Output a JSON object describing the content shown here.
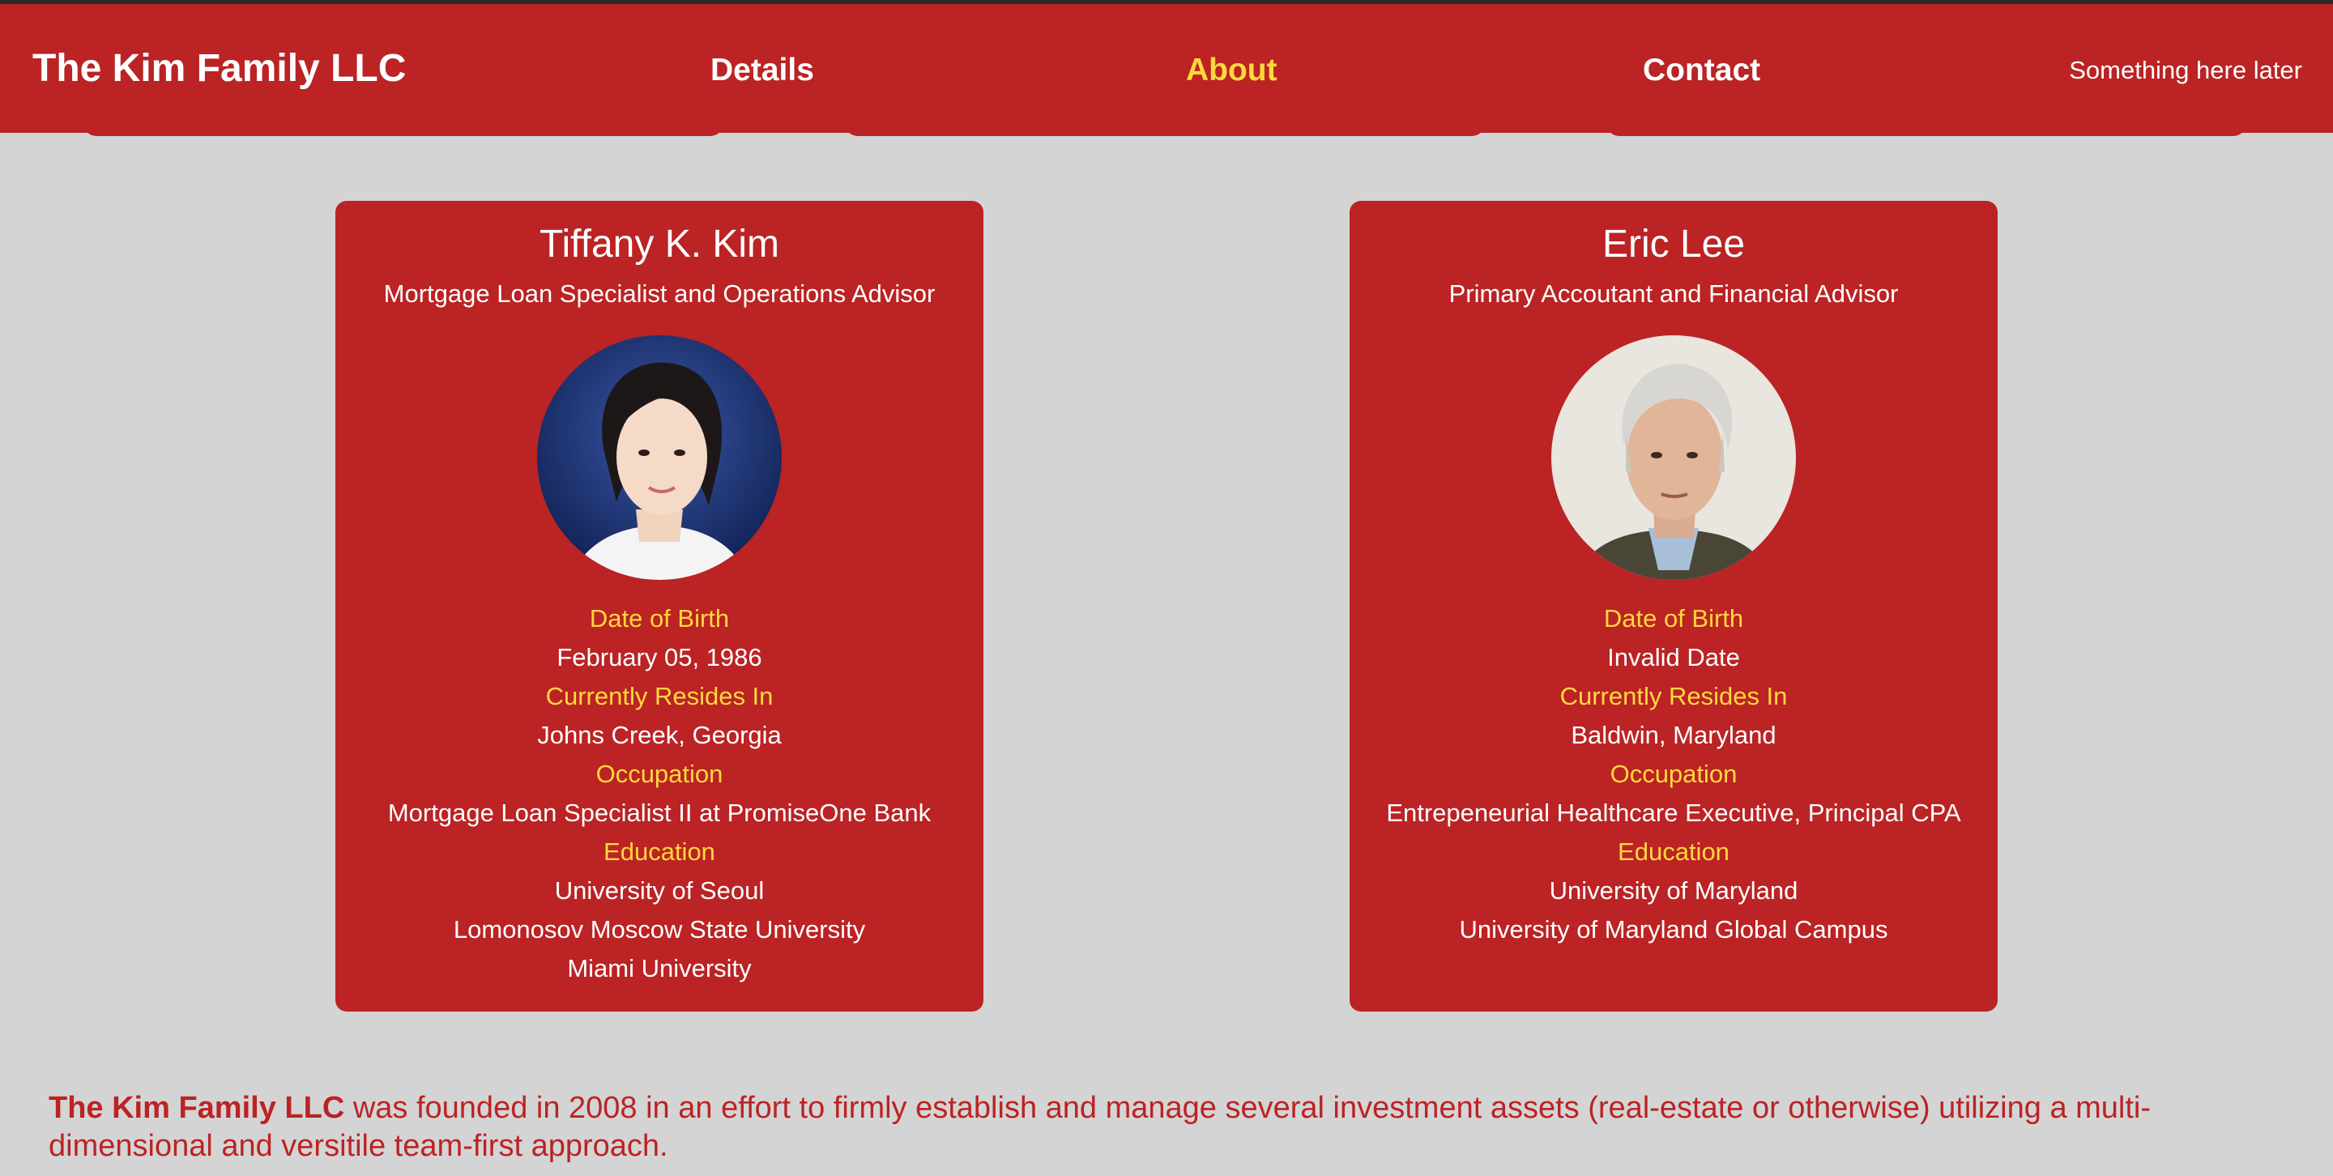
{
  "header": {
    "brand": "The Kim Family LLC",
    "nav": [
      {
        "label": "Details",
        "active": false
      },
      {
        "label": "About",
        "active": true
      },
      {
        "label": "Contact",
        "active": false
      }
    ],
    "note": "Something here later"
  },
  "people": [
    {
      "name": "Tiffany K. Kim",
      "title": "Mortgage Loan Specialist and Operations Advisor",
      "dob_label": "Date of Birth",
      "dob": "February 05, 1986",
      "resides_label": "Currently Resides In",
      "resides": "Johns Creek, Georgia",
      "occupation_label": "Occupation",
      "occupation": "Mortgage Loan Specialist II at PromiseOne Bank",
      "education_label": "Education",
      "education": [
        "University of Seoul",
        "Lomonosov Moscow State University",
        "Miami University"
      ]
    },
    {
      "name": "Eric Lee",
      "title": "Primary Accoutant and Financial Advisor",
      "dob_label": "Date of Birth",
      "dob": "Invalid Date",
      "resides_label": "Currently Resides In",
      "resides": "Baldwin, Maryland",
      "occupation_label": "Occupation",
      "occupation": "Entrepeneurial Healthcare Executive, Principal CPA",
      "education_label": "Education",
      "education": [
        "University of Maryland",
        "University of Maryland Global Campus"
      ]
    }
  ],
  "about": {
    "company": "The Kim Family LLC",
    "text": " was founded in 2008 in an effort to firmly establish and manage several investment assets (real-estate or otherwise) utilizing a multi-dimensional and versitile team-first approach."
  },
  "colors": {
    "brand_red": "#bb2324",
    "accent_yellow": "#ffd83d",
    "background": "#d4d4d4"
  }
}
